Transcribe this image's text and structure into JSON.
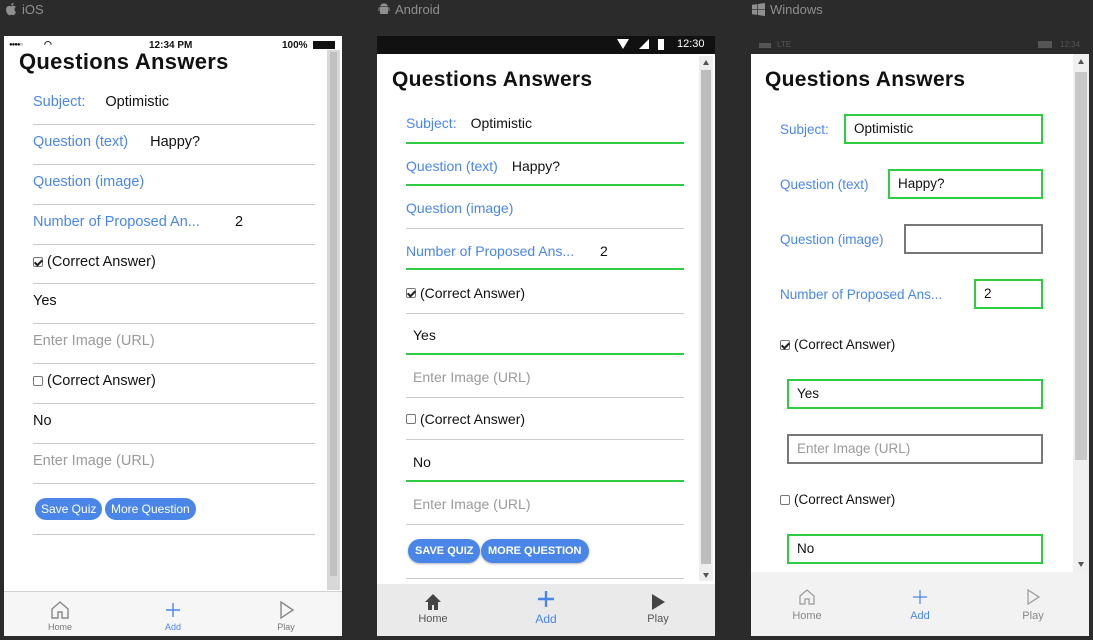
{
  "platforms": {
    "ios": "iOS",
    "android": "Android",
    "windows": "Windows"
  },
  "title": "Questions Answers",
  "ios": {
    "status": {
      "time": "12:34 PM",
      "battery": "100%"
    },
    "subject_label": "Subject:",
    "subject_value": "Optimistic",
    "qtext_label": "Question (text)",
    "qtext_value": "Happy?",
    "qimage_label": "Question (image)",
    "num_label": "Number of Proposed An...",
    "num_value": "2",
    "ans1_check": "(Correct Answer)",
    "ans1_value": "Yes",
    "ans1_image_ph": "Enter Image (URL)",
    "ans2_check": "(Correct Answer)",
    "ans2_value": "No",
    "ans2_image_ph": "Enter Image (URL)",
    "save_btn": "Save Quiz",
    "more_btn": "More Question",
    "tabs": [
      "Home",
      "Add",
      "Play"
    ]
  },
  "android": {
    "status": {
      "time": "12:30"
    },
    "subject_label": "Subject:",
    "subject_value": "Optimistic",
    "qtext_label": "Question (text)",
    "qtext_value": "Happy?",
    "qimage_label": "Question (image)",
    "num_label": "Number of Proposed Ans...",
    "num_value": "2",
    "ans1_check": "(Correct Answer)",
    "ans1_value": "Yes",
    "ans1_image_ph": "Enter Image (URL)",
    "ans2_check": "(Correct Answer)",
    "ans2_value": "No",
    "ans2_image_ph": "Enter Image (URL)",
    "save_btn": "SAVE QUIZ",
    "more_btn": "MORE QUESTION",
    "tabs": [
      "Home",
      "Add",
      "Play"
    ]
  },
  "windows": {
    "status": {
      "carrier": "LTE",
      "time": "12:34"
    },
    "subject_label": "Subject:",
    "subject_value": "Optimistic",
    "qtext_label": "Question (text)",
    "qtext_value": "Happy?",
    "qimage_label": "Question (image)",
    "qimage_value": "",
    "num_label": "Number of Proposed Ans...",
    "num_value": "2",
    "ans1_check": "(Correct Answer)",
    "ans1_value": "Yes",
    "ans1_image_ph": "Enter Image (URL)",
    "ans2_check": "(Correct Answer)",
    "ans2_value": "No",
    "tabs": [
      "Home",
      "Add",
      "Play"
    ]
  },
  "colors": {
    "accent": "#4a86e8",
    "valid_border": "#2ecc40",
    "background": "#2b2b2b"
  }
}
